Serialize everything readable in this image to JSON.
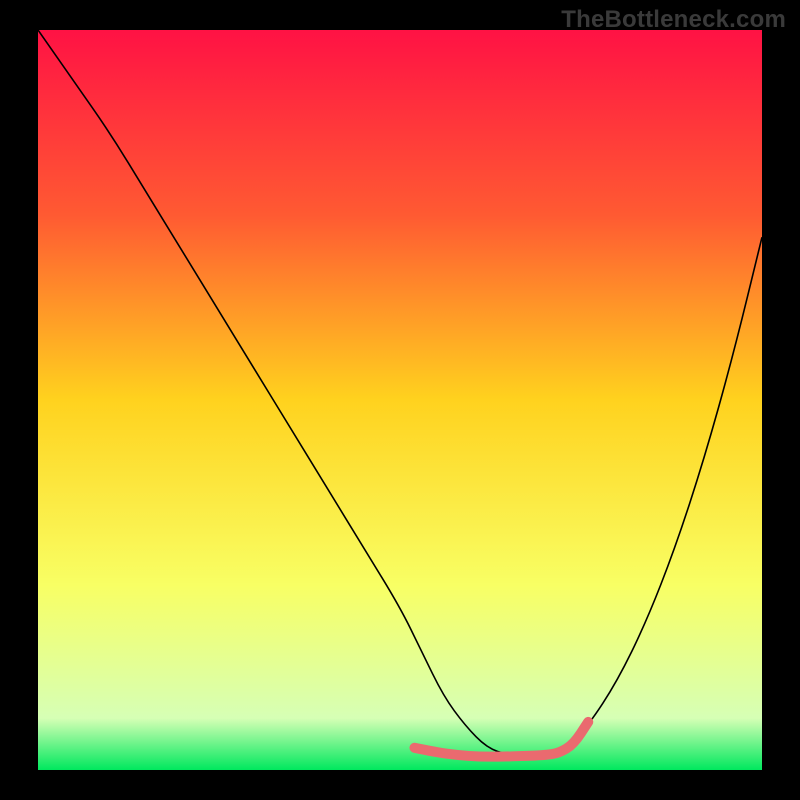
{
  "watermark": {
    "text": "TheBottleneck.com"
  },
  "chart_data": {
    "type": "line",
    "title": "",
    "xlabel": "",
    "ylabel": "",
    "xlim": [
      0,
      100
    ],
    "ylim": [
      0,
      100
    ],
    "grid": false,
    "legend": false,
    "gradient_stops": [
      {
        "offset": 0.0,
        "color": "#ff1244"
      },
      {
        "offset": 0.25,
        "color": "#ff5a32"
      },
      {
        "offset": 0.5,
        "color": "#ffd21e"
      },
      {
        "offset": 0.75,
        "color": "#f8ff64"
      },
      {
        "offset": 0.93,
        "color": "#d6ffb5"
      },
      {
        "offset": 1.0,
        "color": "#00e85e"
      }
    ],
    "series": [
      {
        "name": "curve",
        "color": "#000000",
        "width": 1.6,
        "x": [
          0,
          5,
          10,
          15,
          20,
          25,
          30,
          35,
          40,
          45,
          50,
          53,
          56,
          59,
          62,
          65,
          68,
          70,
          73,
          76,
          80,
          84,
          88,
          92,
          96,
          100
        ],
        "y": [
          100,
          93,
          86,
          78,
          70,
          62,
          54,
          46,
          38,
          30,
          22,
          16,
          10,
          6,
          3,
          2,
          2,
          2,
          3,
          6,
          12,
          20,
          30,
          42,
          56,
          72
        ]
      },
      {
        "name": "fit-region",
        "color": "#ea6a6f",
        "width": 10,
        "linecap": "round",
        "x": [
          52,
          55,
          58,
          61,
          64,
          67,
          70,
          72,
          74,
          76
        ],
        "y": [
          3,
          2.4,
          2.0,
          1.8,
          1.8,
          1.9,
          2.0,
          2.3,
          3.5,
          6.5
        ]
      }
    ]
  }
}
